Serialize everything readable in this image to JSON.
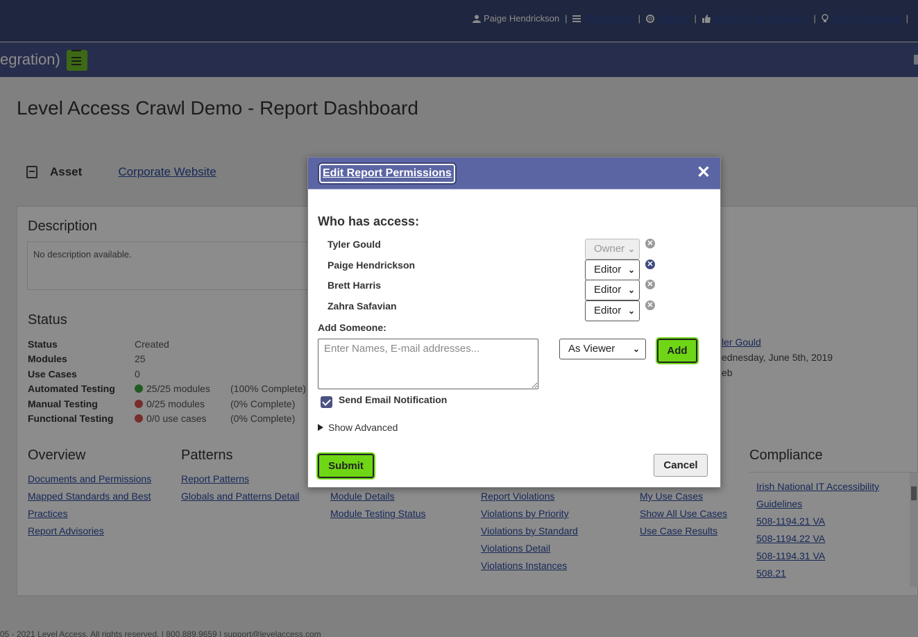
{
  "topbar": {
    "user_name": "Paige Hendrickson",
    "preferences": "Preferences",
    "support": "Support",
    "feedback": "Give Us Your Feedback",
    "ideas": "Share Your Ideas"
  },
  "subbar": {
    "crumb": "egration)"
  },
  "page": {
    "title": "Level Access Crawl Demo - Report Dashboard",
    "asset_label": "Asset",
    "asset_link": "Corporate Website"
  },
  "description": {
    "heading": "Description",
    "text": "No description available."
  },
  "status": {
    "heading": "Status",
    "rows": [
      {
        "key": "Status",
        "value": "Created",
        "pct": "",
        "icon": ""
      },
      {
        "key": "Modules",
        "value": "25",
        "pct": "",
        "icon": ""
      },
      {
        "key": "Use Cases",
        "value": "0",
        "pct": "",
        "icon": ""
      },
      {
        "key": "Automated Testing",
        "value": "25/25 modules",
        "pct": "(100% Complete)",
        "icon": "green"
      },
      {
        "key": "Manual Testing",
        "value": "0/25 modules",
        "pct": "(0% Complete)",
        "icon": "red"
      },
      {
        "key": "Functional Testing",
        "value": "0/0 use cases",
        "pct": "(0% Complete)",
        "icon": "red"
      }
    ]
  },
  "meta_right": {
    "owner_link": "ler Gould",
    "created": "ednesday, June 5th, 2019",
    "type": "eb"
  },
  "sections": {
    "overview": {
      "heading": "Overview",
      "links": [
        "Documents and Permissions",
        "Mapped Standards and Best Practices",
        "Report Advisories"
      ]
    },
    "patterns": {
      "heading": "Patterns",
      "links": [
        "Report Patterns",
        "Globals and Patterns Detail"
      ]
    },
    "modules": {
      "links": [
        "Module Details",
        "Module Testing Status"
      ]
    },
    "violations": {
      "links": [
        "Report Violations",
        "Violations by Priority",
        "Violations by Standard",
        "Violations Detail",
        "Violations Instances"
      ]
    },
    "use_cases": {
      "links": [
        "My Use Cases",
        "Show All Use Cases",
        "Use Case Results"
      ]
    },
    "compliance": {
      "heading": "Compliance",
      "links": [
        "Irish National IT Accessibility Guidelines",
        "508-1194.21 VA",
        "508-1194.22 VA",
        "508-1194.31 VA",
        "508.21"
      ]
    }
  },
  "footer": {
    "text": "05 - 2021 Level Access. All rights reserved. | 800.889.9659 | support@levelaccess.com"
  },
  "modal": {
    "title": "Edit Report Permissions",
    "close_glyph": "✕",
    "who_heading": "Who has access:",
    "people": [
      {
        "name": "Tyler Gould",
        "role": "Owner",
        "disabled": true
      },
      {
        "name": "Paige Hendrickson",
        "role": "Editor",
        "disabled": false
      },
      {
        "name": "Brett Harris",
        "role": "Editor",
        "disabled": false
      },
      {
        "name": "Zahra Safavian",
        "role": "Editor",
        "disabled": false
      }
    ],
    "add_label": "Add Someone:",
    "add_placeholder": "Enter Names, E-mail addresses...",
    "role_value": "As Viewer",
    "add_button": "Add",
    "notify_label": "Send Email Notification",
    "notify_checked": true,
    "advanced_label": "Show Advanced",
    "submit_button": "Submit",
    "cancel_button": "Cancel"
  },
  "colors": {
    "topbar": "#3a4574",
    "modal_header": "#5b65a3",
    "action_green": "#6fd615"
  }
}
